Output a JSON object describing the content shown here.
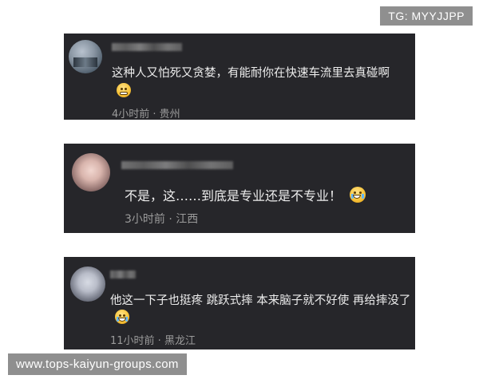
{
  "watermarks": {
    "top_right": "TG: MYYJJPP",
    "bottom_left": "www.tops-kaiyun-groups.com"
  },
  "comments": [
    {
      "text": "这种人又怕死又贪婪，有能耐你在快速车流里去真碰啊",
      "meta": "4小时前 · 贵州",
      "emoji_icon": "grimace-emoji-icon"
    },
    {
      "text": "不是，这……到底是专业还是不专业！",
      "meta": "3小时前 · 江西",
      "emoji_icon": "tears-of-joy-emoji-icon"
    },
    {
      "text": "他这一下子也挺疼 跳跃式摔 本来脑子就不好使 再给摔没了",
      "meta": "11小时前 · 黑龙江",
      "emoji_icon": "laughing-emoji-icon"
    }
  ],
  "colors": {
    "card_background": "#26262a",
    "comment_text": "#ececec",
    "meta_text": "#9b9b9b",
    "watermark_background": "#8f8f8f"
  }
}
